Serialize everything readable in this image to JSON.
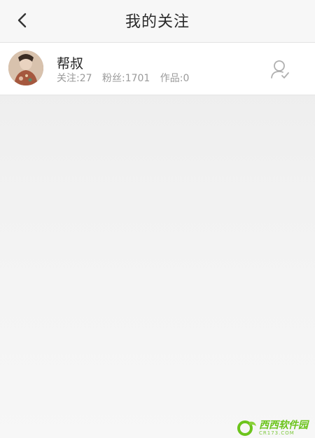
{
  "header": {
    "title": "我的关注"
  },
  "following": [
    {
      "name": "帮叔",
      "follow_label": "关注:27",
      "fans_label": "粉丝:1701",
      "works_label": "作品:0"
    }
  ],
  "icons": {
    "back": "chevron-left-icon",
    "follow_status": "user-check-icon"
  },
  "colors": {
    "title": "#2a2a2a",
    "stats": "#9a9a9a",
    "icon": "#b0b0b0",
    "watermark": "#6cc41c"
  },
  "watermark": {
    "main": "西西软件园",
    "sub": "CR173.COM"
  }
}
